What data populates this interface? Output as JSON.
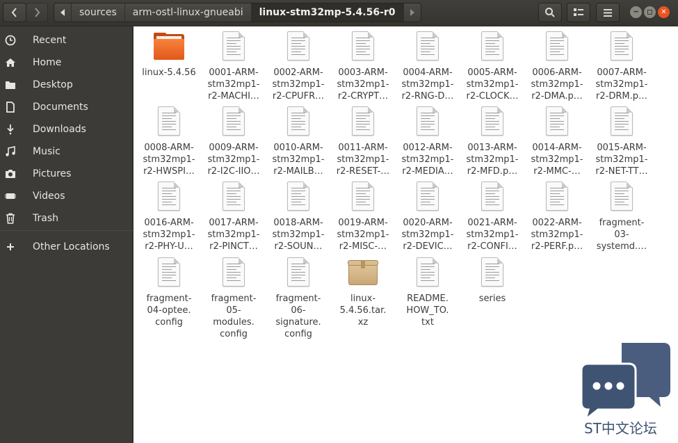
{
  "breadcrumbs": [
    "sources",
    "arm-ostl-linux-gnueabi",
    "linux-stm32mp-5.4.56-r0"
  ],
  "sidebar": {
    "items": [
      {
        "label": "Recent",
        "icon": "recent-icon"
      },
      {
        "label": "Home",
        "icon": "home-icon"
      },
      {
        "label": "Desktop",
        "icon": "desktop-icon"
      },
      {
        "label": "Documents",
        "icon": "documents-icon"
      },
      {
        "label": "Downloads",
        "icon": "downloads-icon"
      },
      {
        "label": "Music",
        "icon": "music-icon"
      },
      {
        "label": "Pictures",
        "icon": "pictures-icon"
      },
      {
        "label": "Videos",
        "icon": "videos-icon"
      },
      {
        "label": "Trash",
        "icon": "trash-icon"
      }
    ],
    "other_locations": "Other Locations"
  },
  "files": [
    {
      "name": "linux-5.4.56",
      "type": "folder"
    },
    {
      "name": "0001-ARM-\nstm32mp1-\nr2-MACHI…",
      "type": "text"
    },
    {
      "name": "0002-ARM-\nstm32mp1-\nr2-CPUFR…",
      "type": "text"
    },
    {
      "name": "0003-ARM-\nstm32mp1-\nr2-CRYPT…",
      "type": "text"
    },
    {
      "name": "0004-ARM-\nstm32mp1-\nr2-RNG-D…",
      "type": "text"
    },
    {
      "name": "0005-ARM-\nstm32mp1-\nr2-CLOCK…",
      "type": "text"
    },
    {
      "name": "0006-ARM-\nstm32mp1-\nr2-DMA.p…",
      "type": "text"
    },
    {
      "name": "0007-ARM-\nstm32mp1-\nr2-DRM.p…",
      "type": "text"
    },
    {
      "name": "0008-ARM-\nstm32mp1-\nr2-HWSPI…",
      "type": "text"
    },
    {
      "name": "0009-ARM-\nstm32mp1-\nr2-I2C-IIO…",
      "type": "text"
    },
    {
      "name": "0010-ARM-\nstm32mp1-\nr2-MAILB…",
      "type": "text"
    },
    {
      "name": "0011-ARM-\nstm32mp1-\nr2-RESET-…",
      "type": "text"
    },
    {
      "name": "0012-ARM-\nstm32mp1-\nr2-MEDIA…",
      "type": "text"
    },
    {
      "name": "0013-ARM-\nstm32mp1-\nr2-MFD.p…",
      "type": "text"
    },
    {
      "name": "0014-ARM-\nstm32mp1-\nr2-MMC-…",
      "type": "text"
    },
    {
      "name": "0015-ARM-\nstm32mp1-\nr2-NET-TT…",
      "type": "text"
    },
    {
      "name": "0016-ARM-\nstm32mp1-\nr2-PHY-U…",
      "type": "text"
    },
    {
      "name": "0017-ARM-\nstm32mp1-\nr2-PINCT…",
      "type": "text"
    },
    {
      "name": "0018-ARM-\nstm32mp1-\nr2-SOUN…",
      "type": "text"
    },
    {
      "name": "0019-ARM-\nstm32mp1-\nr2-MISC-…",
      "type": "text"
    },
    {
      "name": "0020-ARM-\nstm32mp1-\nr2-DEVIC…",
      "type": "text"
    },
    {
      "name": "0021-ARM-\nstm32mp1-\nr2-CONFI…",
      "type": "text"
    },
    {
      "name": "0022-ARM-\nstm32mp1-\nr2-PERF.p…",
      "type": "text"
    },
    {
      "name": "fragment-\n03-\nsystemd.…",
      "type": "text"
    },
    {
      "name": "fragment-\n04-optee.\nconfig",
      "type": "text"
    },
    {
      "name": "fragment-\n05-\nmodules.\nconfig",
      "type": "text"
    },
    {
      "name": "fragment-\n06-\nsignature.\nconfig",
      "type": "text"
    },
    {
      "name": "linux-\n5.4.56.tar.\nxz",
      "type": "archive"
    },
    {
      "name": "README.\nHOW_TO.\ntxt",
      "type": "text"
    },
    {
      "name": "series",
      "type": "text"
    }
  ],
  "watermark": "ST中文论坛",
  "colors": {
    "accent": "#e95420",
    "watermark": "#3f5373"
  }
}
